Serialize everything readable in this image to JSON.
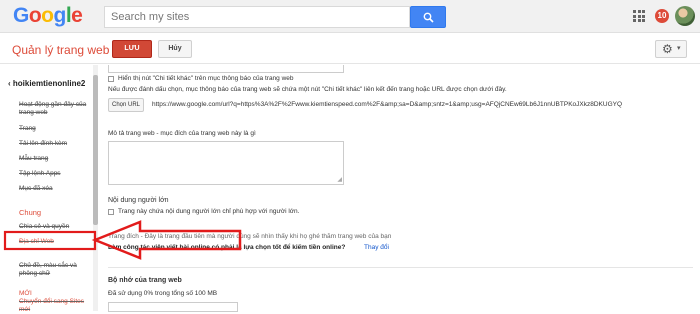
{
  "header": {
    "logo_letters": [
      {
        "ch": "G",
        "color": "#4285f4"
      },
      {
        "ch": "o",
        "color": "#ea4335"
      },
      {
        "ch": "o",
        "color": "#fbbc05"
      },
      {
        "ch": "g",
        "color": "#4285f4"
      },
      {
        "ch": "l",
        "color": "#34a853"
      },
      {
        "ch": "e",
        "color": "#ea4335"
      }
    ],
    "search_placeholder": "Search my sites",
    "notification_count": "10"
  },
  "toolbar": {
    "title": "Quản lý trang web",
    "save_label": "LƯU",
    "cancel_label": "Hủy",
    "settings_icon": "gear-icon",
    "settings_caret": "▾"
  },
  "sidebar": {
    "site_name": "hoikiemtienonline2",
    "items": [
      {
        "label": "Hoạt động gần đây của trang web"
      },
      {
        "label": "Trang"
      },
      {
        "label": "Tải lên đính kèm"
      },
      {
        "label": "Mẫu trang"
      },
      {
        "label": "Tập lệnh Apps"
      },
      {
        "label": "Mục đã xóa"
      }
    ],
    "section_general": "Chung",
    "general_items": [
      {
        "label": "Chia sẻ và quyền"
      },
      {
        "label": "Địa chỉ Web"
      },
      {
        "label": "Chủ đề, màu sắc và phông chữ"
      }
    ],
    "new_label": "MỚI",
    "convert_label": "Chuyển đổi sang Sites mới"
  },
  "main": {
    "show_more_checkbox_label": "Hiển thị nút \"Chi tiết khác\" trên mục thông báo của trang web",
    "more_info_desc": "Nếu được đánh dấu chọn, mục thông báo của trang web sẽ chứa một nút \"Chi tiết khác\" liên kết đến trang hoặc URL được chọn dưới đây.",
    "choose_url_label": "Chọn URL",
    "url_value": "https://www.google.com/url?q=https%3A%2F%2Fwww.kiemtienspeed.com%2F&amp;sa=D&amp;sntz=1&amp;usg=AFQjCNEw69Lb6J1nnUBTPKoJXkz8DKUGYQ",
    "description_label": "Mô tả trang web - mục đích của trang web này là gì",
    "adult_heading": "Nội dung người lớn",
    "adult_checkbox_label": "Trang này chứa nội dung người lớn chỉ phù hợp với người lớn.",
    "landing_text": "Trang đích - Đây là trang đầu tiên mà người dùng sẽ nhìn thấy khi họ ghé thăm trang web của bạn",
    "landing_page_value": "Làm công tác viên viết bài online có phải là lựa chọn tốt để kiếm tiền online?",
    "change_link": "Thay đổi",
    "storage_heading": "Bộ nhớ của trang web",
    "storage_used": "Đã sử dụng 0% trong tổng số 100 MB",
    "storage_used_fraction": 0
  },
  "annotation": {
    "arrow_color": "#e21b1b"
  }
}
